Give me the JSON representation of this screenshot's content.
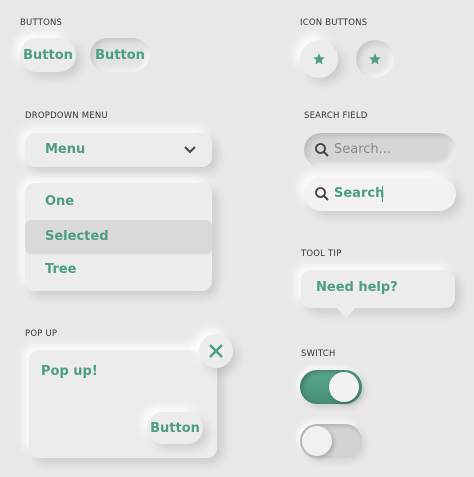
{
  "sections": {
    "buttons": "BUTTONS",
    "icon_buttons": "ICON BUTTONS",
    "dropdown": "DROPDOWN MENU",
    "search": "SEARCH FIELD",
    "tooltip": "TOOL TIP",
    "popup": "POP UP",
    "switch": "SWITCH"
  },
  "buttons": {
    "button1": "Button",
    "button2": "Button"
  },
  "icon_buttons": {
    "icon": "star-icon"
  },
  "dropdown": {
    "selected": "Menu",
    "items": [
      "One",
      "Selected",
      "Tree"
    ],
    "highlighted_index": 1
  },
  "search": {
    "placeholder": "Search...",
    "value": "Search"
  },
  "tooltip": {
    "text": "Need help?"
  },
  "popup": {
    "title": "Pop up!",
    "button": "Button"
  },
  "switches": [
    {
      "on": true
    },
    {
      "on": false
    }
  ],
  "colors": {
    "accent": "#4d9e80",
    "bg": "#e8e8e8"
  }
}
